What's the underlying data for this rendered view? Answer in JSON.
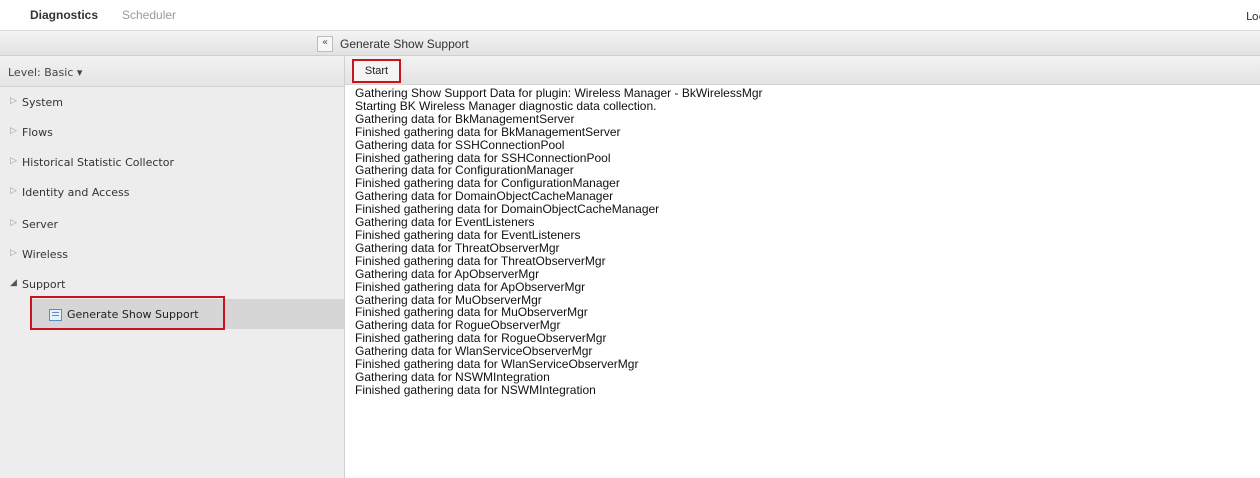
{
  "tabs": {
    "active": "Diagnostics",
    "inactive": "Scheduler",
    "logout": "Log"
  },
  "panel": {
    "collapse_icon": "«",
    "title": "Generate Show Support"
  },
  "sidebar": {
    "level_label": "Level: Basic ▾",
    "items": [
      {
        "label": "System",
        "arrow": "▷"
      },
      {
        "label": "Flows",
        "arrow": "▷"
      },
      {
        "label": "Historical Statistic Collector",
        "arrow": "▷"
      },
      {
        "label": "Identity and Access",
        "arrow": "▷"
      },
      {
        "label": "Server",
        "arrow": "▷"
      },
      {
        "label": "Wireless",
        "arrow": "▷"
      },
      {
        "label": "Support",
        "arrow": "◢"
      }
    ],
    "sub_item": {
      "label": "Generate Show Support",
      "icon": "document-icon"
    }
  },
  "toolbar": {
    "start_label": "Start"
  },
  "log": [
    "Gathering Show Support Data for plugin: Wireless Manager - BkWirelessMgr",
    "Starting BK Wireless Manager diagnostic data collection.",
    "Gathering data for BkManagementServer",
    "Finished gathering data for BkManagementServer",
    "Gathering data for SSHConnectionPool",
    "Finished gathering data for SSHConnectionPool",
    "Gathering data for ConfigurationManager",
    "Finished gathering data for ConfigurationManager",
    "Gathering data for DomainObjectCacheManager",
    "Finished gathering data for DomainObjectCacheManager",
    "Gathering data for EventListeners",
    "Finished gathering data for EventListeners",
    "Gathering data for ThreatObserverMgr",
    "Finished gathering data for ThreatObserverMgr",
    "Gathering data for ApObserverMgr",
    "Finished gathering data for ApObserverMgr",
    "Gathering data for MuObserverMgr",
    "Finished gathering data for MuObserverMgr",
    "Gathering data for RogueObserverMgr",
    "Finished gathering data for RogueObserverMgr",
    "Gathering data for WlanServiceObserverMgr",
    "Finished gathering data for WlanServiceObserverMgr",
    "Gathering data for NSWMIntegration",
    "Finished gathering data for NSWMIntegration"
  ],
  "colors": {
    "highlight": "#c9141c",
    "sidebar_bg": "#ededed",
    "selected_bg": "#d6d6d6"
  }
}
